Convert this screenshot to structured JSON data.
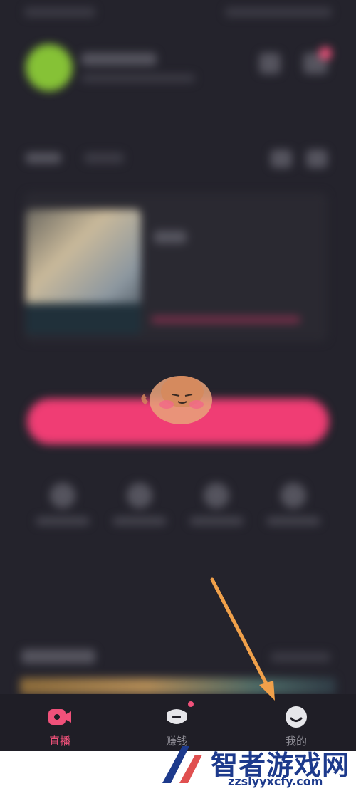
{
  "tabbar": {
    "items": [
      {
        "label": "直播",
        "icon": "live-video-icon",
        "active": true
      },
      {
        "label": "赚钱",
        "icon": "earn-money-icon",
        "active": false
      },
      {
        "label": "我的",
        "icon": "profile-face-icon",
        "active": false
      }
    ]
  },
  "colors": {
    "background": "#24232c",
    "accent": "#f0517a",
    "primary_button": "#f03d74",
    "arrow": "#f0a04a",
    "watermark": "#1d3a8c"
  },
  "watermark": {
    "title": "智者游戏网",
    "url": "zzslyyxcfy.com"
  }
}
